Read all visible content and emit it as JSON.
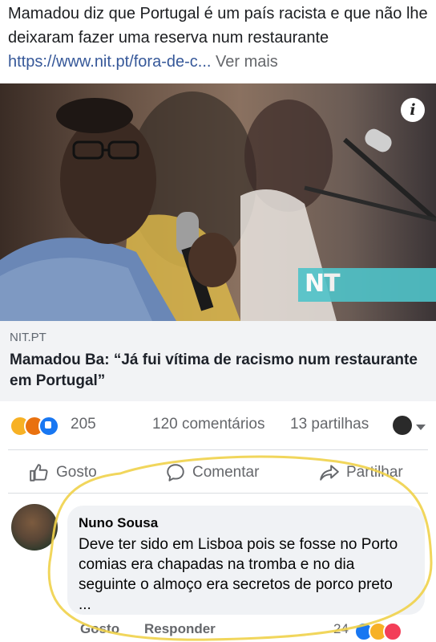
{
  "post": {
    "text_main": "Mamadou diz que Portugal é um país racista e que não lhe deixaram fazer uma reserva num restaurante ",
    "link_text": "https://www.nit.pt/fora-de-c...",
    "see_more": " Ver mais"
  },
  "hero": {
    "info_glyph": "i",
    "badge_text": "NT"
  },
  "link_preview": {
    "domain": "NIT.PT",
    "headline": "Mamadou Ba: “Já fui vítima de racismo num restaurante em Portugal”"
  },
  "stats": {
    "reaction_count": "205",
    "comments": "120 comentários",
    "shares": "13 partilhas",
    "reactions": [
      "haha",
      "angry",
      "like"
    ]
  },
  "actions": {
    "like": "Gosto",
    "comment": "Comentar",
    "share": "Partilhar"
  },
  "comment": {
    "author": "Nuno Sousa",
    "body": "Deve ter sido em Lisboa pois se fosse no Porto comias era chapadas na tromba e no dia seguinte o almoço era secretos de porco preto ...",
    "like": "Gosto",
    "reply": "Responder",
    "reaction_count": "24",
    "reactions": [
      "like",
      "haha",
      "love"
    ]
  },
  "colors": {
    "link": "#365899",
    "muted": "#65676b",
    "annotation": "#f0d24a",
    "nt_badge": "#4fc3c9"
  }
}
